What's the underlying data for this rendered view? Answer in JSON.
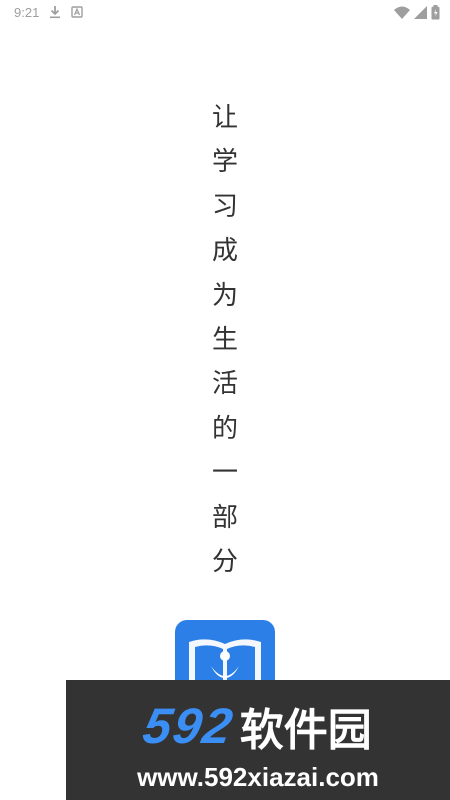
{
  "status_bar": {
    "time": "9:21",
    "icons": [
      "download-icon",
      "notification-icon",
      "wifi-icon",
      "cell-signal-icon",
      "battery-icon"
    ]
  },
  "slogan": {
    "text": "让学习成为生活的一部分",
    "chars": [
      "让",
      "学",
      "习",
      "成",
      "为",
      "生",
      "活",
      "的",
      "一",
      "部",
      "分"
    ]
  },
  "app_logo": {
    "icon": "book-person-icon",
    "color": "#2b7fe6"
  },
  "watermark": {
    "brand_number": "592",
    "brand_name": "软件园",
    "url": "www.592xiazai.com",
    "accent_color": "#3b8ff4",
    "background_color": "#333333"
  }
}
